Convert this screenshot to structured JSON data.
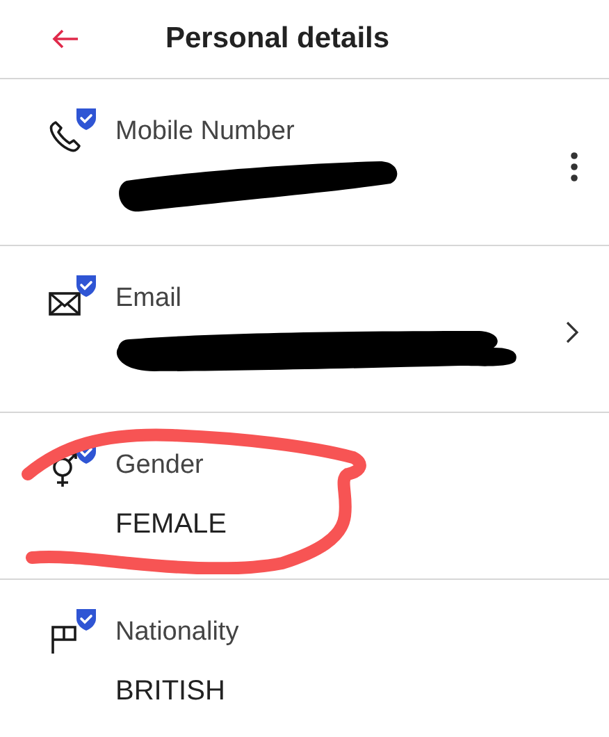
{
  "header": {
    "title": "Personal details"
  },
  "rows": [
    {
      "kind": "phone",
      "label": "Mobile Number",
      "verified": true,
      "redacted": true,
      "annotated": false
    },
    {
      "kind": "mail",
      "label": "Email",
      "verified": true,
      "redacted": true,
      "annotated": false
    },
    {
      "kind": "gender",
      "label": "Gender",
      "verified": true,
      "redacted": false,
      "value": "FEMALE",
      "annotated": true
    },
    {
      "kind": "flag",
      "label": "Nationality",
      "verified": true,
      "redacted": false,
      "value": "BRITISH",
      "annotated": false
    }
  ]
}
